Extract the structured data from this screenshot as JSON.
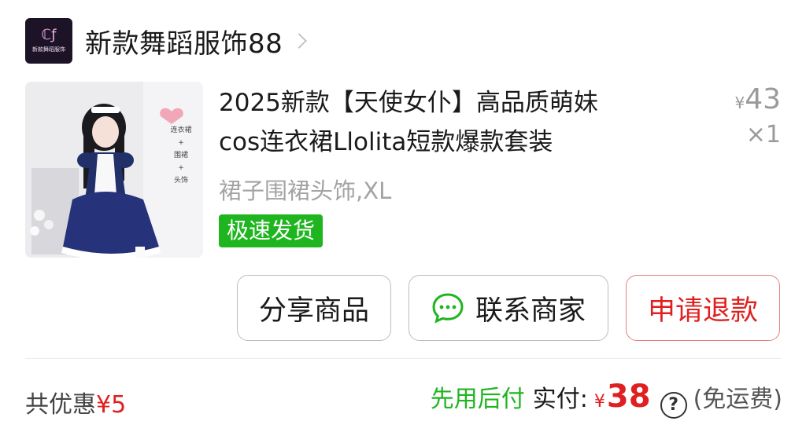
{
  "shop": {
    "logo_mark": "ℂƒ",
    "logo_text": "新款舞蹈服饰",
    "name": "新款舞蹈服饰88"
  },
  "product": {
    "title_line1": "2025新款【天使女仆】高品质萌妹",
    "title_line2": "cos连衣裙Llolita短款爆款套装",
    "price_currency": "¥",
    "price": "43",
    "quantity": "×1",
    "sku": "裙子围裙头饰,XL",
    "tag": "极速发货",
    "image_labels": [
      "连衣裙",
      "+",
      "围裙",
      "+",
      "头饰"
    ]
  },
  "actions": {
    "share": "分享商品",
    "contact": "联系商家",
    "refund": "申请退款"
  },
  "footer": {
    "discount_label": "共优惠",
    "discount_amount": "¥5",
    "bnpl": "先用后付",
    "paid_label": "实付:",
    "paid_currency": "¥",
    "paid_amount": "38",
    "help_symbol": "?",
    "shipping": "(免运费)"
  },
  "colors": {
    "accent_red": "#e02020",
    "accent_green": "#1fb51f",
    "muted_gray": "#a3a3a3"
  }
}
